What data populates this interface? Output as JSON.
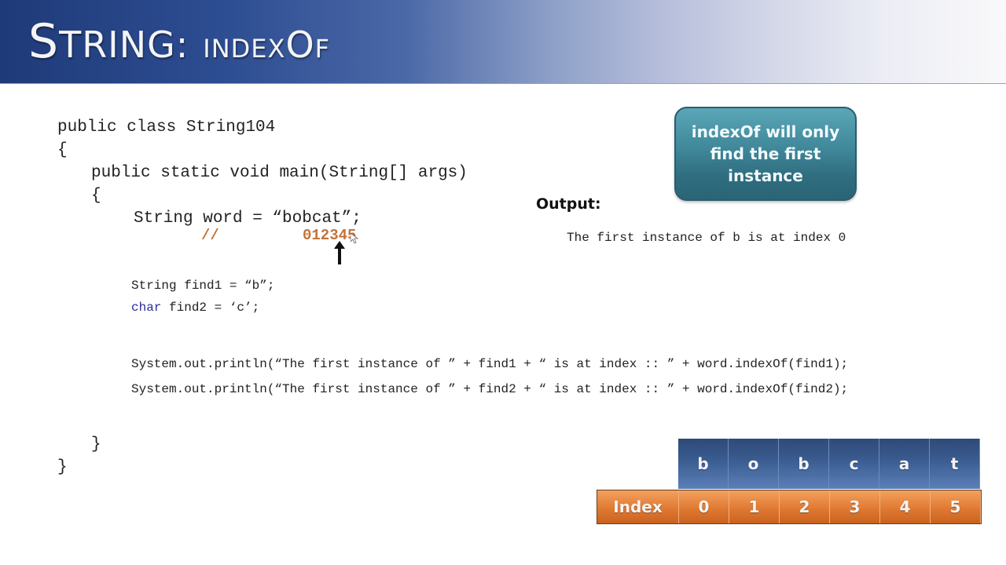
{
  "slide": {
    "title": {
      "first_letter": "S",
      "rest": "TRING:",
      "second_first": "INDEX",
      "second_o": "O",
      "second_f": "F"
    }
  },
  "code": {
    "line1": "public class String104",
    "line2": "{",
    "line3": "public static void main(String[] args)",
    "line4": "{",
    "line5": "String word = “bobcat”;",
    "comment_slashes": "//",
    "comment_indices": "012345",
    "line6": "String find1 = “b”;",
    "line7_kw": "char",
    "line7_rest": " find2 = ‘c’;",
    "line8": "System.out.println(“The first instance of ” + find1 + “ is at index :: ” + word.indexOf(find1);",
    "line9": "System.out.println(“The first instance of ” + find2 + “ is at index :: ” + word.indexOf(find2);",
    "line10": "}",
    "line11": "}"
  },
  "callout": {
    "text": "indexOf will only find the first instance"
  },
  "output": {
    "label": "Output:",
    "lines": [
      "The first instance of b is at index 0"
    ]
  },
  "index_table": {
    "letters": [
      "b",
      "o",
      "b",
      "c",
      "a",
      "t"
    ],
    "row_label": "Index",
    "indices": [
      "0",
      "1",
      "2",
      "3",
      "4",
      "5"
    ],
    "colors": {
      "letter_bg": "#3b5d92",
      "index_bg": "#e07a32"
    }
  },
  "pointer": {
    "points_to_index": 3
  }
}
